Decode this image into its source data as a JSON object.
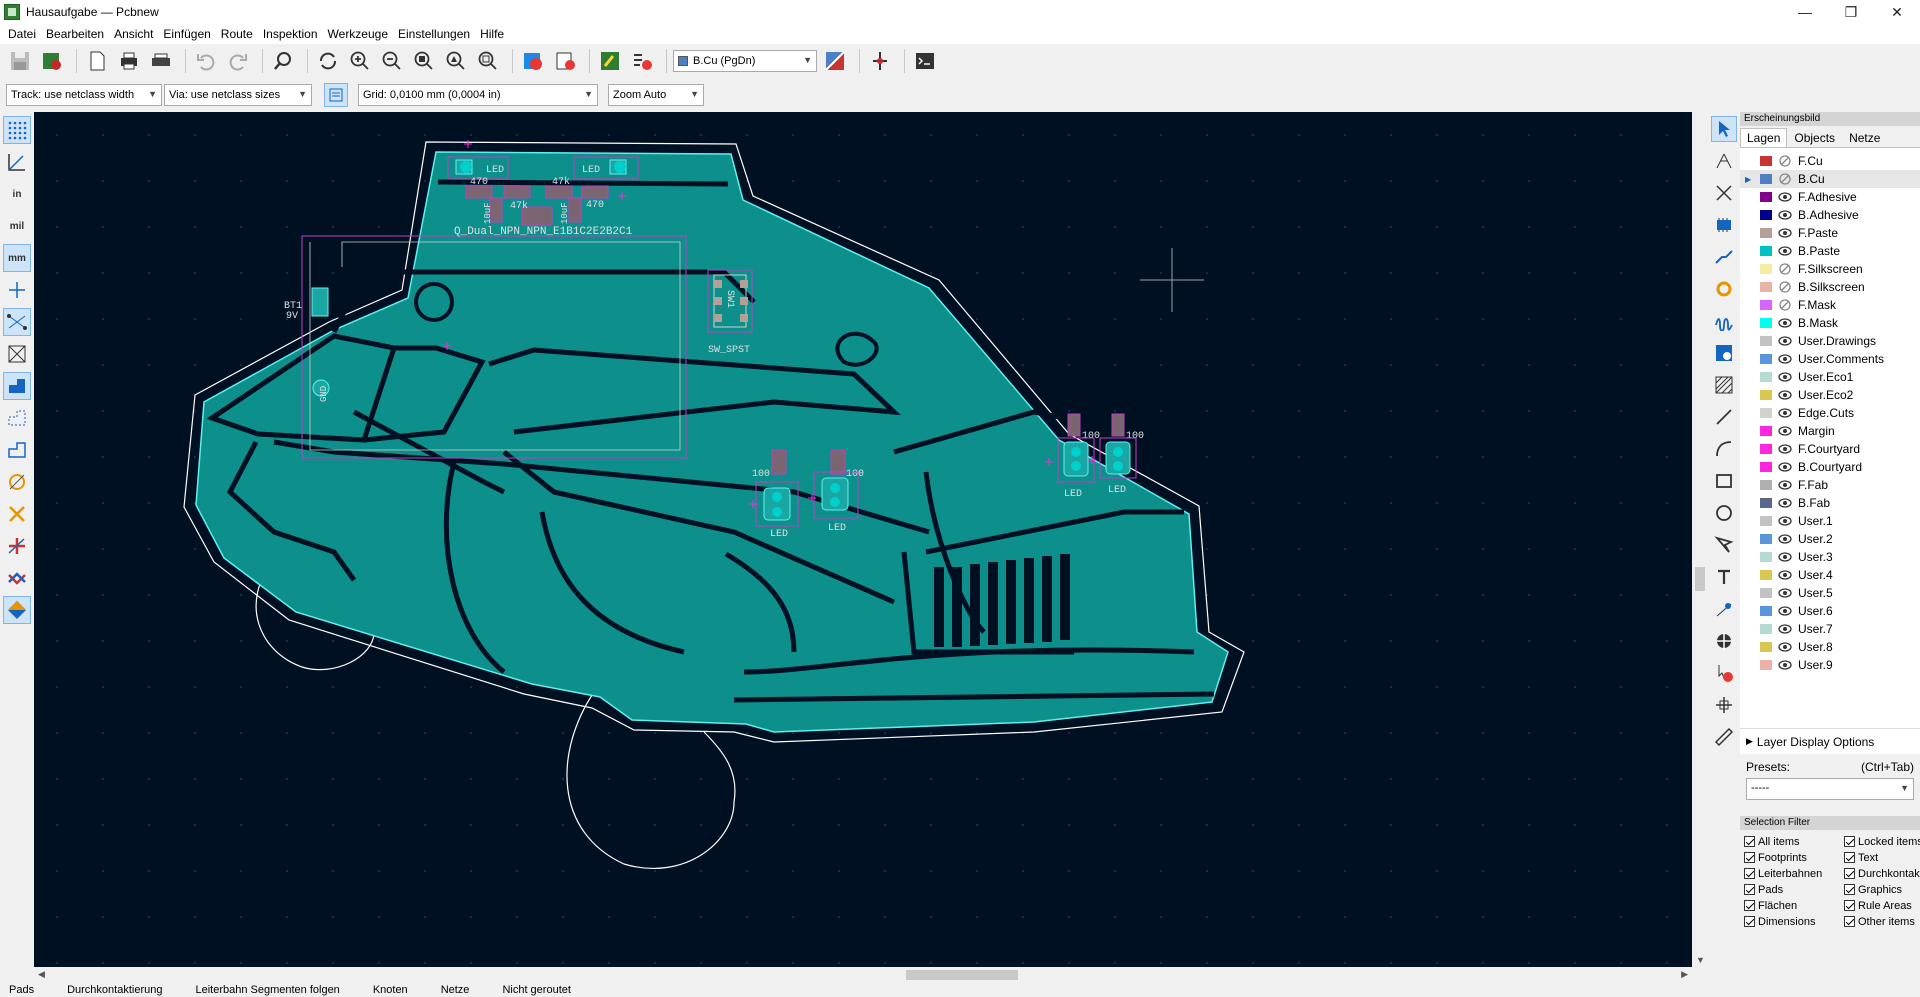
{
  "window": {
    "title": "Hausaufgabe — Pcbnew",
    "minimize": "—",
    "maximize": "❐",
    "close": "✕"
  },
  "menu": [
    "Datei",
    "Bearbeiten",
    "Ansicht",
    "Einfügen",
    "Route",
    "Inspektion",
    "Werkzeuge",
    "Einstellungen",
    "Hilfe"
  ],
  "toolbar": {
    "active_layer": "B.Cu (PgDn)",
    "active_layer_color": "#4d7fc4"
  },
  "aux_toolbar": {
    "track": "Track: use netclass width",
    "via": "Via: use netclass sizes",
    "grid": "Grid: 0,0100 mm (0,0004 in)",
    "zoom": "Zoom Auto"
  },
  "left_toolbar": {
    "inch": "in",
    "mil": "mil",
    "mm": "mm"
  },
  "canvas": {
    "background": "#001023",
    "board_color": "#0d8f8c",
    "outline_color": "#ffffff",
    "labels": {
      "led1": "LED",
      "led2": "LED",
      "r470a": "470",
      "r47ka": "47k",
      "r47kb": "47k",
      "r470b": "470",
      "cap1": "10uF",
      "cap2": "10uF",
      "ic": "Q_Dual_NPN_NPN_E1B1C2E2B2C1",
      "bt1": "BT1",
      "bt1v": "9V",
      "gnd": "GND",
      "sw1": "SW1",
      "swsps": "SW_SPST",
      "r100a": "100",
      "r100b": "100",
      "r100c": "100",
      "r100d": "100",
      "led3": "LED",
      "led4": "LED",
      "led5": "LED",
      "led6": "LED"
    }
  },
  "panel": {
    "header": "Erscheinungsbild",
    "tabs": [
      "Lagen",
      "Objects",
      "Netze"
    ],
    "layers": [
      {
        "name": "F.Cu",
        "color": "#c83434",
        "visible": false
      },
      {
        "name": "B.Cu",
        "color": "#4d7fc4",
        "visible": false,
        "selected": true
      },
      {
        "name": "F.Adhesive",
        "color": "#84008a",
        "visible": true
      },
      {
        "name": "B.Adhesive",
        "color": "#00008a",
        "visible": true
      },
      {
        "name": "F.Paste",
        "color": "#b4a096",
        "visible": true
      },
      {
        "name": "B.Paste",
        "color": "#00c2c2",
        "visible": true
      },
      {
        "name": "F.Silkscreen",
        "color": "#f2eda1",
        "visible": false
      },
      {
        "name": "B.Silkscreen",
        "color": "#e8b2a7",
        "visible": false
      },
      {
        "name": "F.Mask",
        "color": "#d864ff",
        "visible": false
      },
      {
        "name": "B.Mask",
        "color": "#02ffee",
        "visible": true
      },
      {
        "name": "User.Drawings",
        "color": "#c2c2c2",
        "visible": true
      },
      {
        "name": "User.Comments",
        "color": "#5994dc",
        "visible": true
      },
      {
        "name": "User.Eco1",
        "color": "#b4dbd2",
        "visible": true
      },
      {
        "name": "User.Eco2",
        "color": "#d8c852",
        "visible": true
      },
      {
        "name": "Edge.Cuts",
        "color": "#d0d2cd",
        "visible": true
      },
      {
        "name": "Margin",
        "color": "#ff26e2",
        "visible": true
      },
      {
        "name": "F.Courtyard",
        "color": "#ff26e2",
        "visible": true
      },
      {
        "name": "B.Courtyard",
        "color": "#ff26e2",
        "visible": true
      },
      {
        "name": "F.Fab",
        "color": "#afafaf",
        "visible": true
      },
      {
        "name": "B.Fab",
        "color": "#58658c",
        "visible": true
      },
      {
        "name": "User.1",
        "color": "#c2c2c2",
        "visible": true
      },
      {
        "name": "User.2",
        "color": "#5994dc",
        "visible": true
      },
      {
        "name": "User.3",
        "color": "#b4dbd2",
        "visible": true
      },
      {
        "name": "User.4",
        "color": "#d8c852",
        "visible": true
      },
      {
        "name": "User.5",
        "color": "#c2c2c2",
        "visible": true
      },
      {
        "name": "User.6",
        "color": "#5994dc",
        "visible": true
      },
      {
        "name": "User.7",
        "color": "#b4dbd2",
        "visible": true
      },
      {
        "name": "User.8",
        "color": "#d8c852",
        "visible": true
      },
      {
        "name": "User.9",
        "color": "#e8b2a7",
        "visible": true
      }
    ],
    "layer_display_options": "Layer Display Options",
    "presets_label": "Presets:",
    "presets_shortcut": "(Ctrl+Tab)",
    "presets_value": "-----",
    "selection_filter": "Selection Filter",
    "filters": [
      "All items",
      "Locked items",
      "Footprints",
      "Text",
      "Leiterbahnen",
      "Durchkontaktierungen",
      "Pads",
      "Graphics",
      "Flächen",
      "Rule Areas",
      "Dimensions",
      "Other items"
    ]
  },
  "status": [
    "Pads",
    "Durchkontaktierung",
    "Leiterbahn Segmenten folgen",
    "Knoten",
    "Netze",
    "Nicht geroutet"
  ]
}
